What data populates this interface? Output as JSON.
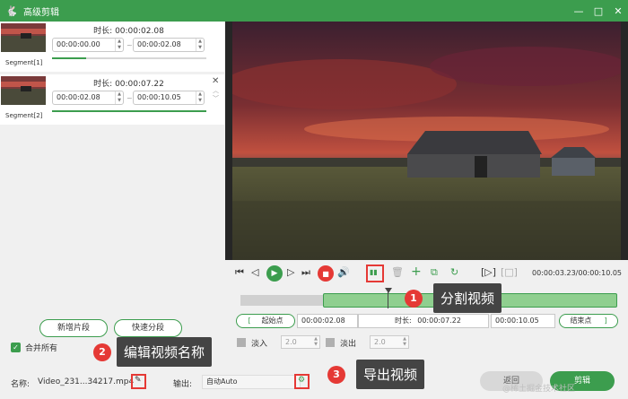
{
  "window": {
    "title": "高级剪辑"
  },
  "segments": [
    {
      "duration": "时长: 00:00:02.08",
      "start": "00:00:00.00",
      "end": "00:00:02.08",
      "label": "Segment[1]",
      "dash": "~"
    },
    {
      "duration": "时长: 00:00:07.22",
      "start": "00:00:02.08",
      "end": "00:00:10.05",
      "label": "Segment[2]",
      "dash": "~"
    }
  ],
  "left": {
    "add_segment": "新增片段",
    "quick_split": "快速分段",
    "merge_all": "合并所有"
  },
  "player": {
    "time_display": "00:00:03.23/00:00:10.05",
    "start_point": "起始点",
    "end_point": "结束点",
    "start_time": "00:00:02.08",
    "duration_label": "时长:",
    "duration_value": "00:00:07.22",
    "end_time": "00:00:10.05",
    "fade_in_label": "淡入",
    "fade_in_value": "2.0",
    "fade_out_label": "淡出",
    "fade_out_value": "2.0",
    "start_bracket": "[",
    "end_bracket": "]"
  },
  "footer": {
    "name_label": "名称:",
    "name_value": "Video_231...34217.mp4",
    "output_label": "输出:",
    "output_value": "自动Auto",
    "back_button": "返回",
    "cut_button": "剪辑"
  },
  "callouts": [
    {
      "num": "1",
      "text": "分割视频"
    },
    {
      "num": "2",
      "text": "编辑视频名称"
    },
    {
      "num": "3",
      "text": "导出视频"
    }
  ],
  "watermark": "@稀土掘金技术社区",
  "colors": {
    "accent": "#3c9d4e",
    "highlight": "#e53935"
  }
}
